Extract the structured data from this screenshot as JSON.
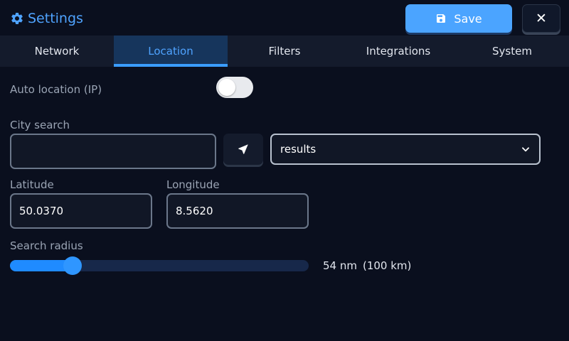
{
  "header": {
    "title": "Settings",
    "save_label": "Save",
    "close_label": "✕",
    "accent_color": "#4fa3ff"
  },
  "tabs": [
    {
      "label": "Network",
      "active": false
    },
    {
      "label": "Location",
      "active": true
    },
    {
      "label": "Filters",
      "active": false
    },
    {
      "label": "Integrations",
      "active": false
    },
    {
      "label": "System",
      "active": false
    }
  ],
  "location": {
    "auto_location_label": "Auto location (IP)",
    "auto_location_enabled": false,
    "city_search_label": "City search",
    "city_search_value": "",
    "results_select_value": "results",
    "latitude_label": "Latitude",
    "latitude_value": "50.0370",
    "longitude_label": "Longitude",
    "longitude_value": "8.5620",
    "radius_label": "Search radius",
    "radius_nm": "54 nm",
    "radius_km": "(100 km)",
    "radius_fraction": 0.21
  }
}
